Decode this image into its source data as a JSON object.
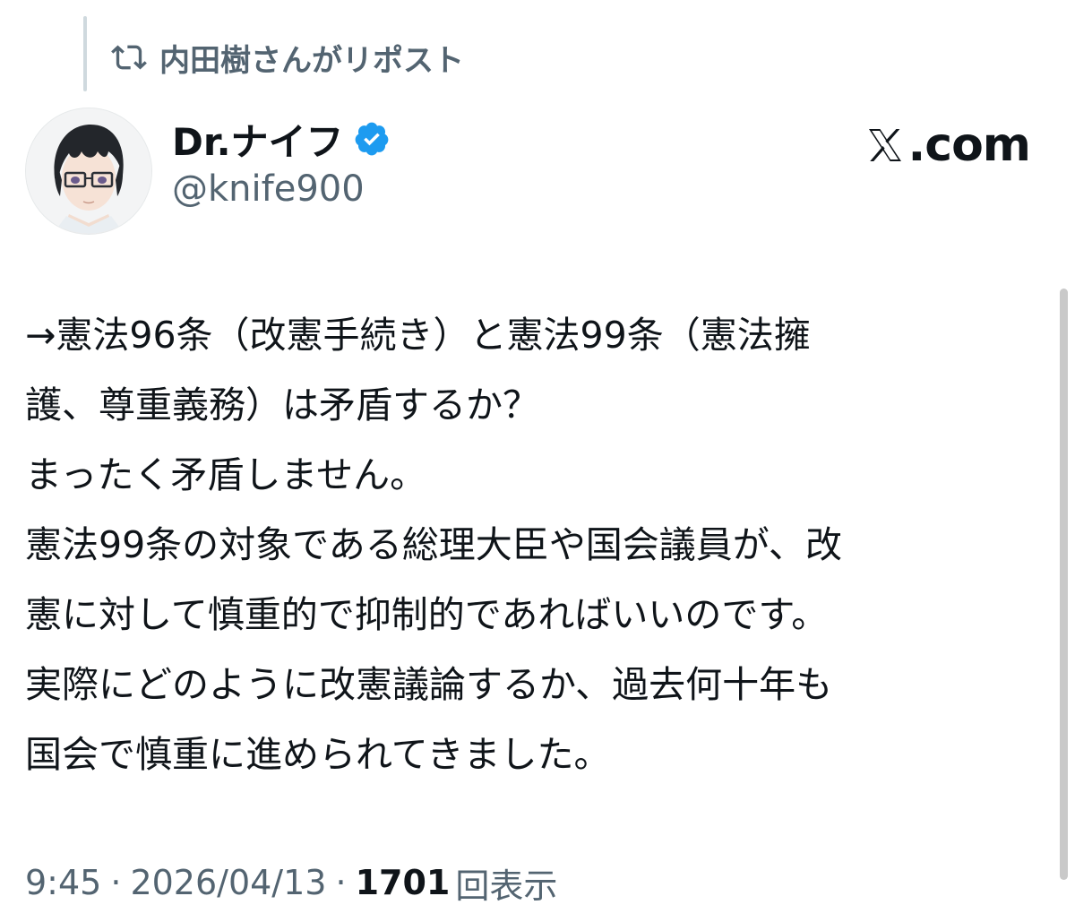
{
  "repost": {
    "icon": "repost-icon",
    "text": "内田樹さんがリポスト"
  },
  "author": {
    "display_name": "Dr.ナイフ",
    "handle": "@knife900",
    "verified": true,
    "verified_color": "#1d9bf0"
  },
  "brand": {
    "label": ".com",
    "logo": "x-logo-icon"
  },
  "tweet": {
    "lines": [
      "→憲法96条（改憲手続き）と憲法99条（憲法擁",
      "護、尊重義務）は矛盾するか？",
      "まったく矛盾しません。",
      "憲法99条の対象である総理大臣や国会議員が、改",
      "憲に対して慎重的で抑制的であればいいのです。",
      "実際にどのように改憲議論するか、過去何十年も",
      "国会で慎重に進められてきました。"
    ]
  },
  "meta": {
    "time": "9:45",
    "separator": "·",
    "date": "2026/04/13",
    "views_count": "1701",
    "views_label": "回表示"
  },
  "colors": {
    "text_primary": "#0f1419",
    "text_secondary": "#536471",
    "thread_line": "#cfd9de"
  }
}
